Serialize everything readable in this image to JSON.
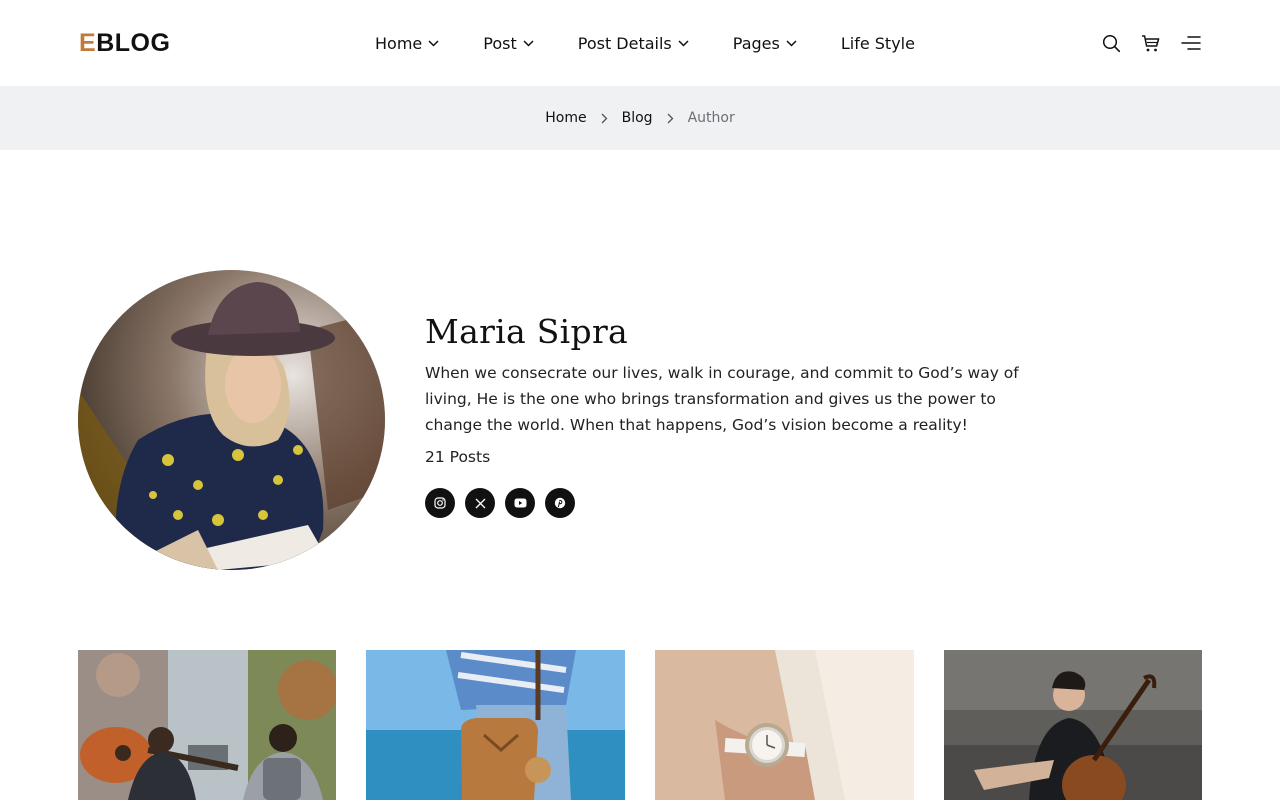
{
  "brand": {
    "logo_first": "E",
    "logo_rest": "BLOG",
    "accent": "#c17a3a"
  },
  "nav": {
    "items": [
      {
        "label": "Home",
        "has_dropdown": true
      },
      {
        "label": "Post",
        "has_dropdown": true
      },
      {
        "label": "Post Details",
        "has_dropdown": true
      },
      {
        "label": "Pages",
        "has_dropdown": true
      },
      {
        "label": "Life Style",
        "has_dropdown": false
      }
    ]
  },
  "header_icons": [
    "search-icon",
    "cart-icon",
    "menu-icon"
  ],
  "breadcrumb": {
    "home": "Home",
    "blog": "Blog",
    "current": "Author"
  },
  "author": {
    "name": "Maria Sipra",
    "bio": "When we consecrate our lives, walk in courage, and commit to God’s way of living, He is the one who brings transformation and gives us the power to change the world. When that happens, God’s vision become a reality!",
    "posts": "21 Posts",
    "socials": [
      "instagram-icon",
      "x-icon",
      "youtube-icon",
      "pinterest-icon"
    ]
  },
  "posts": [
    {
      "image": "street-guitar-backpackers"
    },
    {
      "image": "leather-bag-seaside"
    },
    {
      "image": "wristwatch-closeup"
    },
    {
      "image": "cellist-playing"
    }
  ],
  "colors": {
    "crumb_bg": "#eff1f3",
    "text": "#111111",
    "muted": "#6b6f75"
  }
}
